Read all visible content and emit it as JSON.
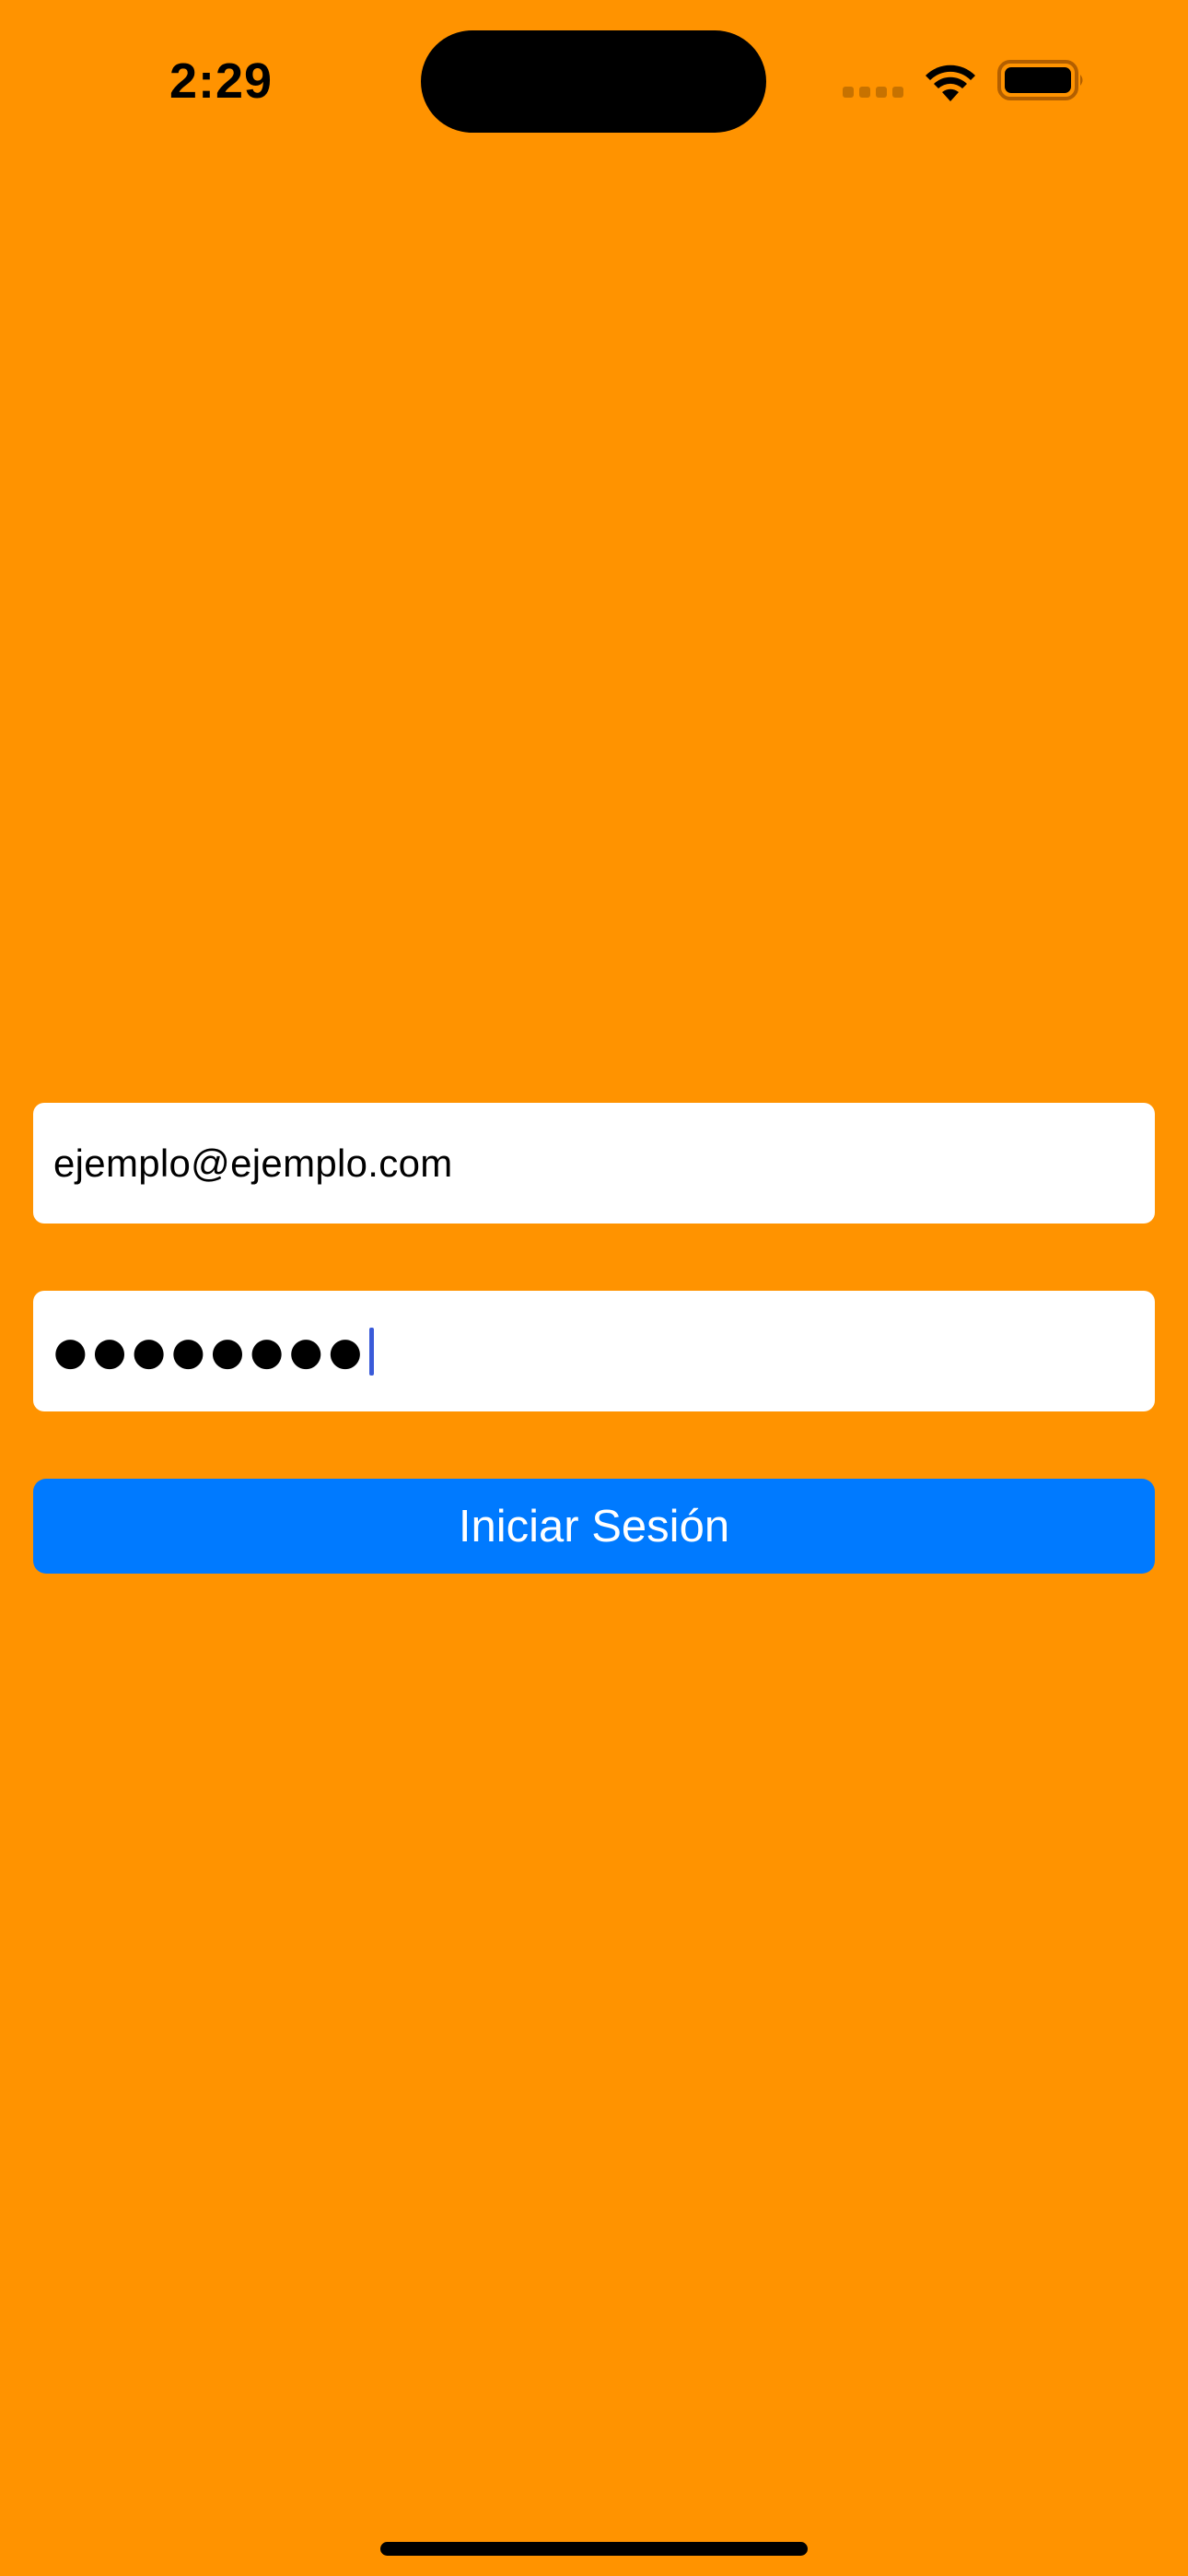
{
  "status_bar": {
    "time": "2:29",
    "icons": [
      "signal-icon",
      "wifi-icon",
      "battery-icon"
    ]
  },
  "login_form": {
    "email": {
      "value": "ejemplo@ejemplo.com"
    },
    "password": {
      "masked_value": "●●●●●●●●"
    },
    "submit_label": "Iniciar Sesión"
  },
  "colors": {
    "background": "#FF9300",
    "field_background": "#FFFFFF",
    "button_background": "#007AFF",
    "button_text": "#FFFFFF",
    "cursor": "#3A5BD9"
  }
}
